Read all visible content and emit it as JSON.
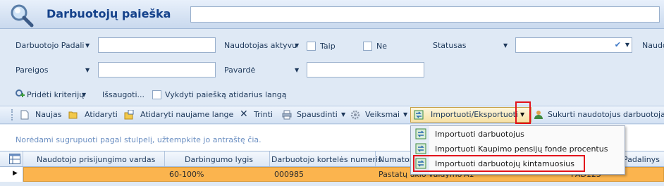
{
  "header": {
    "title": "Darbuotojų paieška",
    "search_value": ""
  },
  "filters": {
    "row1": {
      "darbuotojo_padali": {
        "label": "Darbuotojo Padali",
        "value": ""
      },
      "naudotojas_aktyvus": {
        "label": "Naudotojas aktyvu",
        "yes": "Taip",
        "no": "Ne"
      },
      "statusas": {
        "label": "Statusas",
        "value": ""
      },
      "naudo": {
        "label": "Naudo"
      }
    },
    "row2": {
      "pareigos": {
        "label": "Pareigos",
        "value": ""
      },
      "pavarde": {
        "label": "Pavardė",
        "value": ""
      }
    },
    "criteria": {
      "add": "Pridėti kriterijų",
      "save": "Išsaugoti...",
      "run": "Vykdyti paiešką atidarius langą"
    }
  },
  "toolbar": {
    "new": "Naujas",
    "open": "Atidaryti",
    "open_new_window": "Atidaryti naujame lange",
    "delete": "Trinti",
    "print": "Spausdinti",
    "actions": "Veiksmai",
    "import_export": "Importuoti/Eksportuoti",
    "create_users": "Sukurti naudotojus darbuotojar"
  },
  "group_panel": {
    "text": "Norėdami sugrupuoti pagal stulpelį, užtempkite jo antraštę čia."
  },
  "grid": {
    "columns": [
      "Naudotojo prisijungimo vardas",
      "Darbingumo lygis",
      "Darbuotojo kortelės numeris",
      "Numator",
      "Padalinys"
    ],
    "rows": [
      {
        "user": "",
        "level": "60-100%",
        "card": "000985",
        "numator": "Pastatų ūkio valdymo",
        "code": "A1",
        "dept": "PAD125"
      }
    ]
  },
  "menu": {
    "items": [
      "Importuoti darbuotojus",
      "Importuoti Kaupimo pensijų fonde procentus",
      "Importuoti darbuotojų kintamuosius"
    ]
  },
  "colors": {
    "accent": "#15428b",
    "selected_row": "#fbb44e",
    "highlight": "#e2121b"
  }
}
